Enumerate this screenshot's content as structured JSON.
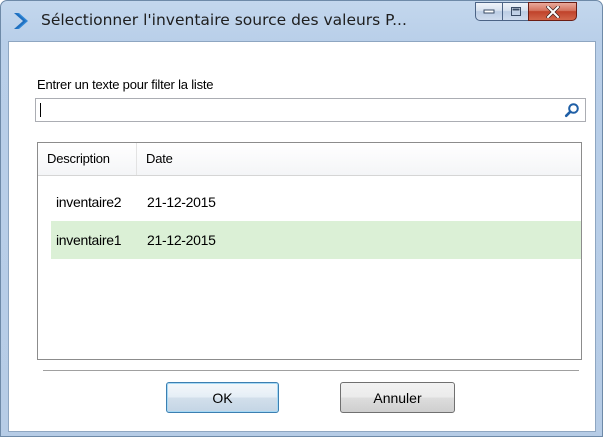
{
  "window": {
    "title": "Sélectionner l'inventaire source des valeurs P...",
    "controls": [
      "minimize",
      "maximize",
      "close"
    ]
  },
  "filter": {
    "label": "Entrer un texte pour filter la liste",
    "value": "",
    "icon": "search-icon"
  },
  "list": {
    "columns": [
      "Description",
      "Date"
    ],
    "rows": [
      {
        "description": "inventaire2",
        "date": "21-12-2015",
        "selected": false
      },
      {
        "description": "inventaire1",
        "date": "21-12-2015",
        "selected": true
      }
    ]
  },
  "buttons": {
    "ok_label": "OK",
    "cancel_label": "Annuler"
  },
  "colors": {
    "selected_row": "#dbf0d6",
    "title_icon": "#2f86d6",
    "close_button": "#c0422a"
  }
}
